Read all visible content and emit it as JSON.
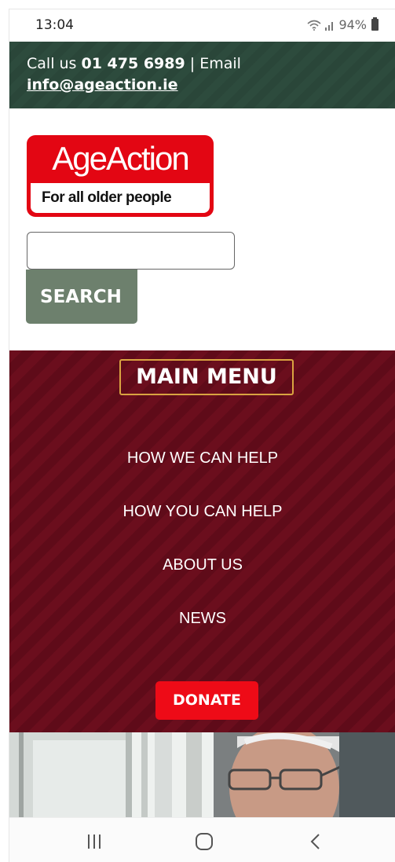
{
  "status_bar": {
    "time": "13:04",
    "signal_text": "",
    "battery": "94%"
  },
  "contact": {
    "call_prefix": "Call us ",
    "phone": "01 475 6989",
    "separator": " | Email",
    "email": "info@ageaction.ie"
  },
  "logo": {
    "name": "AgeAction",
    "tagline": "For all older people"
  },
  "search": {
    "value": "",
    "placeholder": "",
    "button_label": "SEARCH"
  },
  "menu": {
    "title": "MAIN MENU",
    "items": [
      {
        "label": "HOW WE CAN HELP"
      },
      {
        "label": "HOW YOU CAN HELP"
      },
      {
        "label": "ABOUT US"
      },
      {
        "label": "NEWS"
      }
    ],
    "donate_label": "DONATE"
  },
  "colors": {
    "contact_bar": "#2d4b3d",
    "menu_bg": "#6b0e1d",
    "brand_red": "#e30613",
    "search_button": "#6d806d",
    "menu_title_border": "#d9a441"
  },
  "icons": {
    "wifi": "wifi-icon",
    "signal": "signal-icon",
    "battery": "battery-icon",
    "recent_apps": "recent-apps-icon",
    "home": "home-icon",
    "back": "back-icon"
  }
}
